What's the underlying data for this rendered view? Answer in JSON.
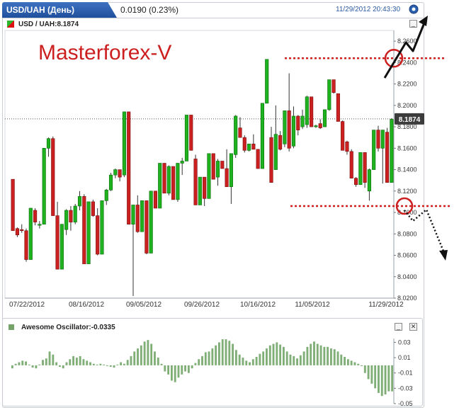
{
  "header": {
    "symbol_title": "USD/UAH (День)",
    "price_change": "0.0190 (0.23%)",
    "datetime": "11/29/2012 20:43:30"
  },
  "main_panel": {
    "symbol_label": "USD / UAH:8.1874",
    "last_price_tag": "8.1874"
  },
  "watermark": "Masterforex-V",
  "oscillator_panel": {
    "label": "Awesome Oscillator:-0.0335"
  },
  "colors": {
    "up": "#1fb21f",
    "down": "#cc1f1f",
    "osc": "#7fae76",
    "watermark": "#cc1f1f",
    "level_line": "#cc1f1f"
  },
  "icons": [
    "info-icon",
    "minimize-icon",
    "close-icon",
    "symbol-color-icon"
  ],
  "chart_data": [
    {
      "type": "ohlc-bar",
      "title": "USD / UAH:8.1874",
      "ylim": [
        8.02,
        8.27
      ],
      "yticks": [
        8.02,
        8.04,
        8.06,
        8.08,
        8.1,
        8.12,
        8.14,
        8.16,
        8.18,
        8.2,
        8.22,
        8.24,
        8.26
      ],
      "yticklabels": [
        "8.0200",
        "8.0400",
        "8.0600",
        "8.0800",
        "8.1000",
        "8.1200",
        "8.1400",
        "8.1600",
        "8.1800",
        "8.2000",
        "8.2200",
        "8.2400",
        "8.2600"
      ],
      "xticklabels": [
        "07/22/2012",
        "08/16/2012",
        "09/05/2012",
        "09/26/2012",
        "10/16/2012",
        "11/05/2012",
        "11/29/2012"
      ],
      "last_value": 8.1874,
      "levels": [
        8.244,
        8.106
      ],
      "bars": [
        [
          8.131,
          8.131,
          8.083,
          8.083
        ],
        [
          8.085,
          8.086,
          8.077,
          8.079
        ],
        [
          8.084,
          8.089,
          8.081,
          8.083
        ],
        [
          8.083,
          8.085,
          8.054,
          8.056
        ],
        [
          8.056,
          8.104,
          8.056,
          8.104
        ],
        [
          8.102,
          8.104,
          8.088,
          8.091
        ],
        [
          8.088,
          8.092,
          8.085,
          8.089
        ],
        [
          8.089,
          8.16,
          8.089,
          8.16
        ],
        [
          8.16,
          8.17,
          8.152,
          8.169
        ],
        [
          8.169,
          8.171,
          8.097,
          8.097
        ],
        [
          8.097,
          8.11,
          8.047,
          8.047
        ],
        [
          8.047,
          8.089,
          8.047,
          8.089
        ],
        [
          8.084,
          8.103,
          8.079,
          8.102
        ],
        [
          8.102,
          8.106,
          8.083,
          8.091
        ],
        [
          8.091,
          8.108,
          8.089,
          8.106
        ],
        [
          8.106,
          8.12,
          8.102,
          8.115
        ],
        [
          8.115,
          8.117,
          8.052,
          8.052
        ],
        [
          8.052,
          8.11,
          8.052,
          8.11
        ],
        [
          8.11,
          8.112,
          8.096,
          8.097
        ],
        [
          8.097,
          8.104,
          8.06,
          8.061
        ],
        [
          8.061,
          8.111,
          8.061,
          8.111
        ],
        [
          8.111,
          8.122,
          8.107,
          8.121
        ],
        [
          8.121,
          8.137,
          8.12,
          8.135
        ],
        [
          8.135,
          8.141,
          8.132,
          8.14
        ],
        [
          8.14,
          8.14,
          8.129,
          8.133
        ],
        [
          8.135,
          8.194,
          8.133,
          8.194
        ],
        [
          8.194,
          8.194,
          8.089,
          8.089
        ],
        [
          8.089,
          8.107,
          8.022,
          8.107
        ],
        [
          8.107,
          8.116,
          8.081,
          8.082
        ],
        [
          8.082,
          8.111,
          8.082,
          8.111
        ],
        [
          8.111,
          8.111,
          8.061,
          8.062
        ],
        [
          8.062,
          8.12,
          8.062,
          8.12
        ],
        [
          8.12,
          8.12,
          8.104,
          8.104
        ],
        [
          8.104,
          8.146,
          8.104,
          8.146
        ],
        [
          8.146,
          8.146,
          8.118,
          8.118
        ],
        [
          8.118,
          8.144,
          8.116,
          8.143
        ],
        [
          8.143,
          8.143,
          8.112,
          8.112
        ],
        [
          8.112,
          8.146,
          8.11,
          8.146
        ],
        [
          8.146,
          8.151,
          8.135,
          8.148
        ],
        [
          8.148,
          8.191,
          8.148,
          8.191
        ],
        [
          8.191,
          8.191,
          8.158,
          8.158
        ],
        [
          8.15,
          8.154,
          8.107,
          8.107
        ],
        [
          8.107,
          8.133,
          8.107,
          8.133
        ],
        [
          8.133,
          8.133,
          8.106,
          8.113
        ],
        [
          8.113,
          8.155,
          8.113,
          8.155
        ],
        [
          8.155,
          8.155,
          8.131,
          8.131
        ],
        [
          8.133,
          8.15,
          8.125,
          8.148
        ],
        [
          8.148,
          8.148,
          8.141,
          8.141
        ],
        [
          8.141,
          8.159,
          8.124,
          8.124
        ],
        [
          8.124,
          8.155,
          8.108,
          8.155
        ],
        [
          8.154,
          8.191,
          8.151,
          8.19
        ],
        [
          8.179,
          8.189,
          8.17,
          8.17
        ],
        [
          8.17,
          8.172,
          8.156,
          8.158
        ],
        [
          8.158,
          8.164,
          8.157,
          8.164
        ],
        [
          8.164,
          8.173,
          8.159,
          8.159
        ],
        [
          8.159,
          8.159,
          8.141,
          8.141
        ],
        [
          8.141,
          8.202,
          8.141,
          8.202
        ],
        [
          8.202,
          8.243,
          8.202,
          8.243
        ],
        [
          8.17,
          8.18,
          8.128,
          8.128
        ],
        [
          8.14,
          8.2,
          8.14,
          8.173
        ],
        [
          8.172,
          8.176,
          8.158,
          8.159
        ],
        [
          8.164,
          8.195,
          8.161,
          8.195
        ],
        [
          8.195,
          8.23,
          8.157,
          8.16
        ],
        [
          8.162,
          8.199,
          8.16,
          8.19
        ],
        [
          8.19,
          8.191,
          8.172,
          8.177
        ],
        [
          8.18,
          8.196,
          8.178,
          8.19
        ],
        [
          8.182,
          8.209,
          8.179,
          8.208
        ],
        [
          8.208,
          8.208,
          8.18,
          8.18
        ],
        [
          8.18,
          8.182,
          8.179,
          8.181
        ],
        [
          8.183,
          8.187,
          8.178,
          8.179
        ],
        [
          8.18,
          8.196,
          8.18,
          8.196
        ],
        [
          8.196,
          8.224,
          8.195,
          8.224
        ],
        [
          8.224,
          8.224,
          8.211,
          8.212
        ],
        [
          8.211,
          8.211,
          8.185,
          8.185
        ],
        [
          8.185,
          8.186,
          8.158,
          8.158
        ],
        [
          8.166,
          8.167,
          8.154,
          8.157
        ],
        [
          8.157,
          8.159,
          8.132,
          8.132
        ],
        [
          8.132,
          8.133,
          8.124,
          8.126
        ],
        [
          8.126,
          8.156,
          8.126,
          8.156
        ],
        [
          8.156,
          8.156,
          8.123,
          8.128
        ],
        [
          8.12,
          8.141,
          8.111,
          8.14
        ],
        [
          8.14,
          8.177,
          8.14,
          8.177
        ],
        [
          8.177,
          8.181,
          8.157,
          8.16
        ],
        [
          8.16,
          8.177,
          8.127,
          8.177
        ],
        [
          8.175,
          8.179,
          8.128,
          8.128
        ],
        [
          8.128,
          8.188,
          8.128,
          8.187
        ]
      ]
    },
    {
      "type": "bar",
      "title": "Awesome Oscillator:-0.0335",
      "ylim": [
        -0.05,
        0.035
      ],
      "yticks": [
        0.03,
        0.01,
        -0.01,
        -0.03,
        -0.05
      ],
      "yticklabels": [
        "0.03",
        "0.01",
        "-0.01",
        "-0.03",
        "-0.05"
      ],
      "last_value": -0.0335,
      "values": [
        -0.004,
        0.002,
        0.004,
        0.006,
        0.005,
        0.001,
        -0.003,
        -0.004,
        0.001,
        0.007,
        0.009,
        0.018,
        0.014,
        0.004,
        -0.002,
        -0.004,
        0.004,
        0.008,
        0.012,
        0.01,
        0.012,
        0.008,
        0.006,
        0.004,
        0.002,
        0.001,
        0.002,
        0.001,
        0.0,
        -0.002,
        -0.003,
        0.001,
        0.004,
        0.002,
        0.007,
        0.012,
        0.018,
        0.022,
        0.026,
        0.031,
        0.033,
        0.028,
        0.018,
        0.01,
        0.002,
        -0.008,
        -0.012,
        -0.02,
        -0.022,
        -0.016,
        -0.012,
        -0.008,
        -0.01,
        -0.004,
        0.003,
        0.008,
        0.012,
        0.017,
        0.018,
        0.022,
        0.026,
        0.03,
        0.034,
        0.034,
        0.032,
        0.028,
        0.02,
        0.014,
        0.01,
        0.006,
        0.004,
        0.008,
        0.011,
        0.015,
        0.018,
        0.022,
        0.026,
        0.028,
        0.03,
        0.027,
        0.024,
        0.018,
        0.014,
        0.012,
        0.009,
        0.013,
        0.018,
        0.024,
        0.028,
        0.031,
        0.028,
        0.026,
        0.024,
        0.024,
        0.022,
        0.021,
        0.018,
        0.014,
        0.011,
        0.008,
        0.006,
        0.004,
        0.002,
        -0.001,
        -0.01,
        -0.018,
        -0.024,
        -0.03,
        -0.036,
        -0.04,
        -0.038,
        -0.034,
        -0.034
      ]
    }
  ]
}
